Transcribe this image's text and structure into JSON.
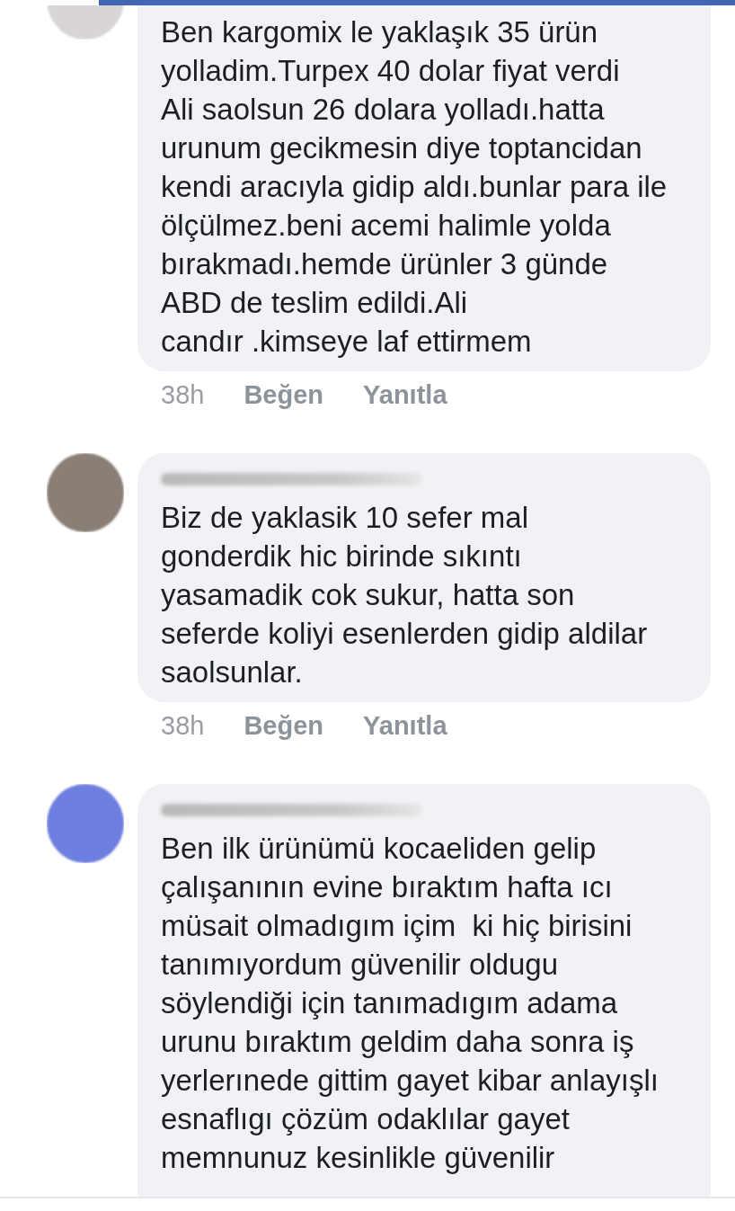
{
  "comments": [
    {
      "color": "#d9d4d8",
      "text": "Ben kargomix le yaklaşık 35 ürün\nyolladim.Turpex 40 dolar fiyat verdi\nAli saolsun 26 dolara yolladı.hatta\nurunum gecikmesin diye toptancidan\nkendi aracıyla gidip aldı.bunlar para ile\nölçülmez.beni acemi halimle yolda\nbırakmadı.hemde ürünler 3 günde\nABD de teslim edildi.Ali\ncandır .kimseye laf ettirmem",
      "time": "38h",
      "like": "Beğen",
      "reply": "Yanıtla"
    },
    {
      "name_blurred": true,
      "color": "#8a7f76",
      "text": "Biz de yaklasik 10 sefer mal\ngonderdik hic birinde sıkıntı\nyasamadik cok sukur, hatta son\nseferde koliyi esenlerden gidip aldilar\nsaolsunlar.",
      "time": "38h",
      "like": "Beğen",
      "reply": "Yanıtla"
    },
    {
      "name_blurred": true,
      "color": "#6f7fe0",
      "text": "Ben ilk ürünümü kocaeliden gelip\nçalışanının evine bıraktım hafta ıcı\nmüsait olmadıgım içim  ki hiç birisini\ntanımıyordum güvenilir oldugu\nsöylendiği için tanımadıgım adama\nurunu bıraktım geldim daha sonra iş\nyerlerınede gittim gayet kibar anlayışlı\nesnaflıgı çözüm odaklılar gayet\nmemnunuz kesinlikle güvenilir"
    }
  ]
}
